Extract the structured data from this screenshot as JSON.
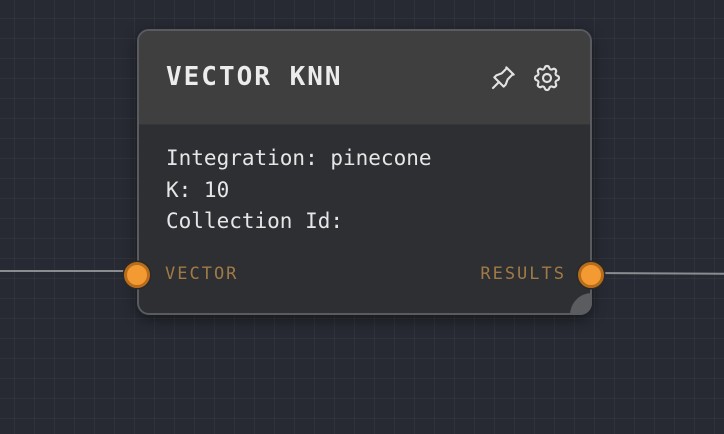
{
  "node": {
    "title": "VECTOR KNN",
    "header_icons": [
      "pin-icon",
      "gear-icon"
    ],
    "properties": [
      "Integration: pinecone",
      "K: 10",
      "Collection Id:"
    ],
    "input_port_label": "VECTOR",
    "output_port_label": "RESULTS"
  },
  "colors": {
    "canvas_background": "#272a33",
    "node_header": "#3f3f3f",
    "node_body": "#2e2f33",
    "port_fill": "#f39a33",
    "port_label": "#a07a46",
    "edge": "#8a8c92"
  }
}
